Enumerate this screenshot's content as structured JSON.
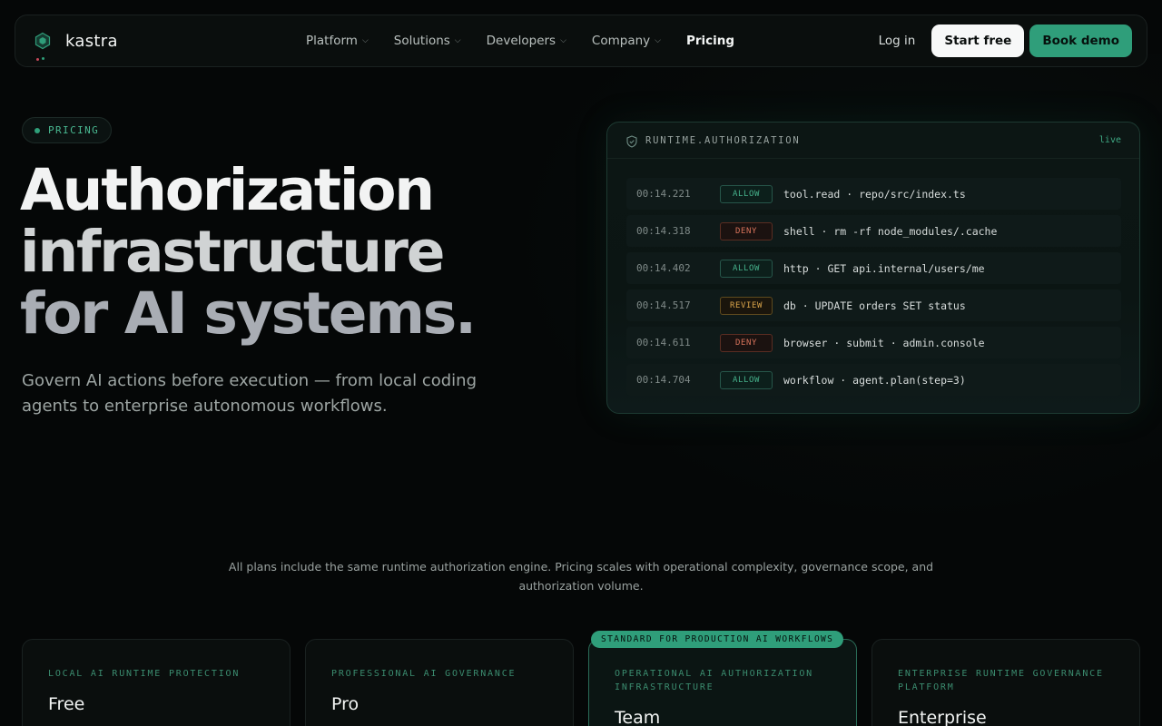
{
  "brand": {
    "name": "kastra"
  },
  "nav": {
    "links": [
      {
        "label": "Platform",
        "chevron": true
      },
      {
        "label": "Solutions",
        "chevron": true
      },
      {
        "label": "Developers",
        "chevron": true
      },
      {
        "label": "Company",
        "chevron": true
      },
      {
        "label": "Pricing",
        "chevron": false
      }
    ],
    "login": "Log in",
    "start_free": "Start free",
    "book_demo": "Book demo"
  },
  "hero": {
    "pill": "PRICING",
    "title_line1": "Authorization",
    "title_line2": "infrastructure",
    "title_line3": "for AI systems.",
    "subtitle": "Govern AI actions before execution — from local coding agents to enterprise autonomous workflows."
  },
  "panel": {
    "title": "RUNTIME.AUTHORIZATION",
    "status": "live",
    "rows": [
      {
        "time": "00:14.221",
        "verdict": "ALLOW",
        "action": "tool.read · repo/src/index.ts"
      },
      {
        "time": "00:14.318",
        "verdict": "DENY",
        "action": "shell · rm -rf node_modules/.cache"
      },
      {
        "time": "00:14.402",
        "verdict": "ALLOW",
        "action": "http · GET api.internal/users/me"
      },
      {
        "time": "00:14.517",
        "verdict": "REVIEW",
        "action": "db · UPDATE orders SET status"
      },
      {
        "time": "00:14.611",
        "verdict": "DENY",
        "action": "browser · submit · admin.console"
      },
      {
        "time": "00:14.704",
        "verdict": "ALLOW",
        "action": "workflow · agent.plan(step=3)"
      }
    ]
  },
  "pricing": {
    "intro_line1": "All plans include the same runtime authorization engine. Pricing scales with operational complexity, governance scope, and",
    "intro_line2": "authorization volume.",
    "featured_ribbon": "STANDARD FOR PRODUCTION AI WORKFLOWS",
    "plans": [
      {
        "eyebrow": "LOCAL AI RUNTIME PROTECTION",
        "name": "Free"
      },
      {
        "eyebrow": "PROFESSIONAL AI GOVERNANCE",
        "name": "Pro"
      },
      {
        "eyebrow": "OPERATIONAL AI AUTHORIZATION INFRASTRUCTURE",
        "name": "Team"
      },
      {
        "eyebrow": "ENTERPRISE RUNTIME GOVERNANCE PLATFORM",
        "name": "Enterprise"
      }
    ]
  },
  "colors": {
    "background": "#050707",
    "accent": "#2f9e7a",
    "allow": "#46b28c",
    "deny": "#d8735b",
    "review": "#d9a44a"
  }
}
